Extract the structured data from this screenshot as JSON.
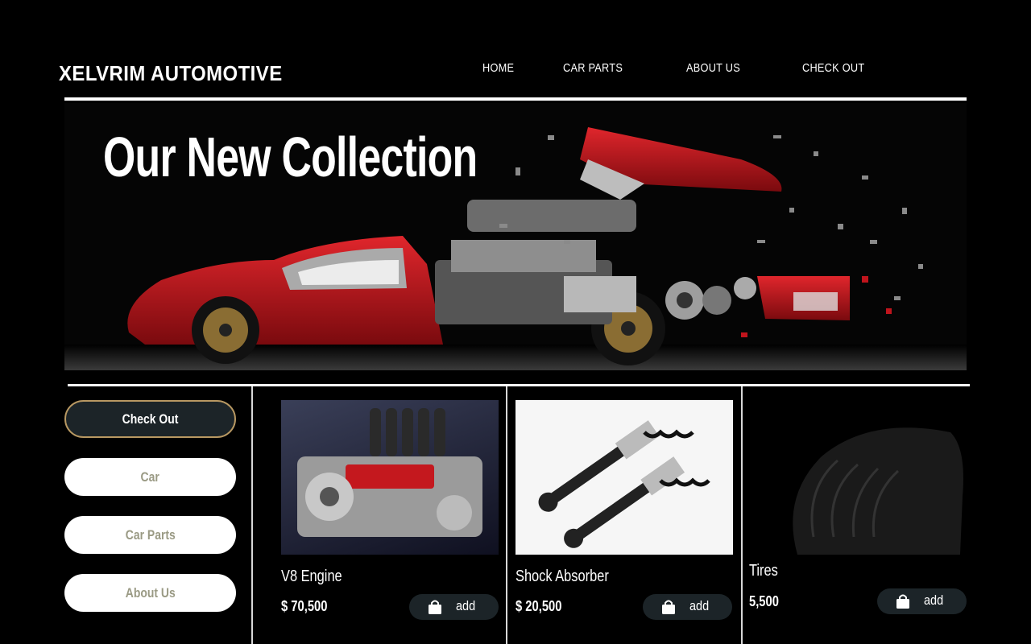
{
  "brand": "XELVRIM AUTOMOTIVE",
  "nav": {
    "home": "HOME",
    "car_parts": "CAR PARTS",
    "about_us": "ABOUT US",
    "check_out": "CHECK OUT"
  },
  "hero": {
    "title": "Our New Collection"
  },
  "sidebar": {
    "checkout": "Check Out",
    "car": "Car",
    "car_parts": "Car Parts",
    "about_us": "About Us"
  },
  "products": [
    {
      "name": "V8 Engine",
      "price": "$ 70,500",
      "add_label": "add"
    },
    {
      "name": "Shock Absorber",
      "price": "$ 20,500",
      "add_label": "add"
    },
    {
      "name": "Tires",
      "price": "5,500",
      "add_label": "add"
    }
  ],
  "colors": {
    "accent_border": "#b89862",
    "button_dark": "#1c2428",
    "car_red": "#c0141c"
  }
}
